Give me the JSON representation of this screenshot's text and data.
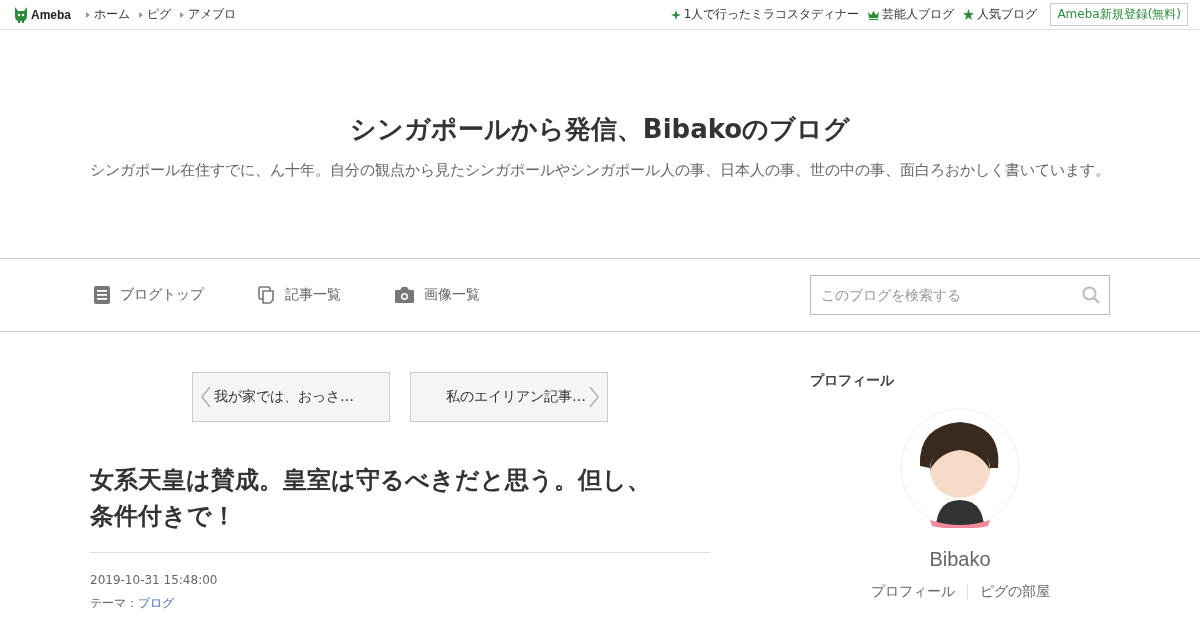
{
  "topbar": {
    "logo": "Ameba",
    "nav": [
      "ホーム",
      "ピグ",
      "アメブロ"
    ],
    "links": [
      {
        "kind": "sparkle",
        "label": "1人で行ったミラコスタディナー"
      },
      {
        "kind": "crown",
        "label": "芸能人ブログ"
      },
      {
        "kind": "star",
        "label": "人気ブログ"
      }
    ],
    "signup": "Ameba新規登録(無料)"
  },
  "header": {
    "title": "シンガポールから発信、Bibakoのブログ",
    "description": "シンガポール在住すでに、ん十年。自分の観点から見たシンガポールやシンガポール人の事、日本人の事、世の中の事、面白ろおかしく書いています。"
  },
  "nav": {
    "items": [
      {
        "kind": "document",
        "label": "ブログトップ"
      },
      {
        "kind": "copy",
        "label": "記事一覧"
      },
      {
        "kind": "camera",
        "label": "画像一覧"
      }
    ],
    "search": {
      "placeholder": "このブログを検索する"
    }
  },
  "pager": {
    "prev": "我が家では、おっさ…",
    "next": "私のエイリアン記事…"
  },
  "article": {
    "title": "女系天皇は賛成。皇室は守るべきだと思う。但し、条件付きで！",
    "date": "2019-10-31 15:48:00",
    "theme_label": "テーマ：",
    "theme": "ブログ"
  },
  "profile": {
    "heading": "プロフィール",
    "name": "Bibako",
    "links": [
      "プロフィール",
      "ピグの部屋"
    ]
  }
}
